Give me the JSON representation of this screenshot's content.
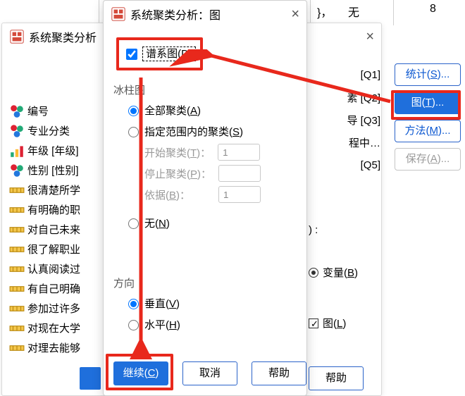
{
  "top": {
    "col1": "}，",
    "col2": "无",
    "col3": "8"
  },
  "parent": {
    "title": "系统聚类分析",
    "close": "×",
    "vars": [
      {
        "label": "编号",
        "icon": "nominal"
      },
      {
        "label": "专业分类",
        "icon": "nominal"
      },
      {
        "label": "年级 [年级]",
        "icon": "ordinal"
      },
      {
        "label": "性别 [性别]",
        "icon": "nominal"
      },
      {
        "label": "很清楚所学",
        "icon": "scale"
      },
      {
        "label": "有明确的职",
        "icon": "scale"
      },
      {
        "label": "对自己未来",
        "icon": "scale"
      },
      {
        "label": "很了解职业",
        "icon": "scale"
      },
      {
        "label": "认真阅读过",
        "icon": "scale"
      },
      {
        "label": "有自己明确",
        "icon": "scale"
      },
      {
        "label": "参加过许多",
        "icon": "scale"
      },
      {
        "label": "对现在大学",
        "icon": "scale"
      },
      {
        "label": "对理去能够",
        "icon": "scale"
      }
    ],
    "peek": [
      {
        "text": "[Q1]"
      },
      {
        "text": "素 [Q2]"
      },
      {
        "text": "导 [Q3]"
      },
      {
        "text": "程中…"
      },
      {
        "text": "[Q5]"
      }
    ],
    "peek_colon": ":",
    "label_case_cb": "图(L)",
    "cluster_radio_var": "变量(B)",
    "btn_help": "帮助",
    "blue_btn": " "
  },
  "side": {
    "stats": "统计(S)...",
    "plots": "图(T)...",
    "method": "方法(M)...",
    "save": "保存(A)..."
  },
  "child": {
    "title": "系统聚类分析：图",
    "close": "×",
    "dendrogram": "谱系图(D)",
    "grp_icicle": "冰柱图",
    "rad_all": "全部聚类(A)",
    "rad_range": "指定范围内的聚类(S)",
    "lbl_start": "开始聚类(T)：",
    "lbl_stop": "停止聚类(P)：",
    "lbl_by": "依据(B)：",
    "start_val": "1",
    "stop_val": "",
    "by_val": "1",
    "rad_none": "无(N)",
    "grp_orient": "方向",
    "rad_vert": "垂直(V)",
    "rad_horz": "水平(H)",
    "btn_continue": "继续(C)",
    "btn_cancel": "取消",
    "btn_help": "帮助"
  }
}
